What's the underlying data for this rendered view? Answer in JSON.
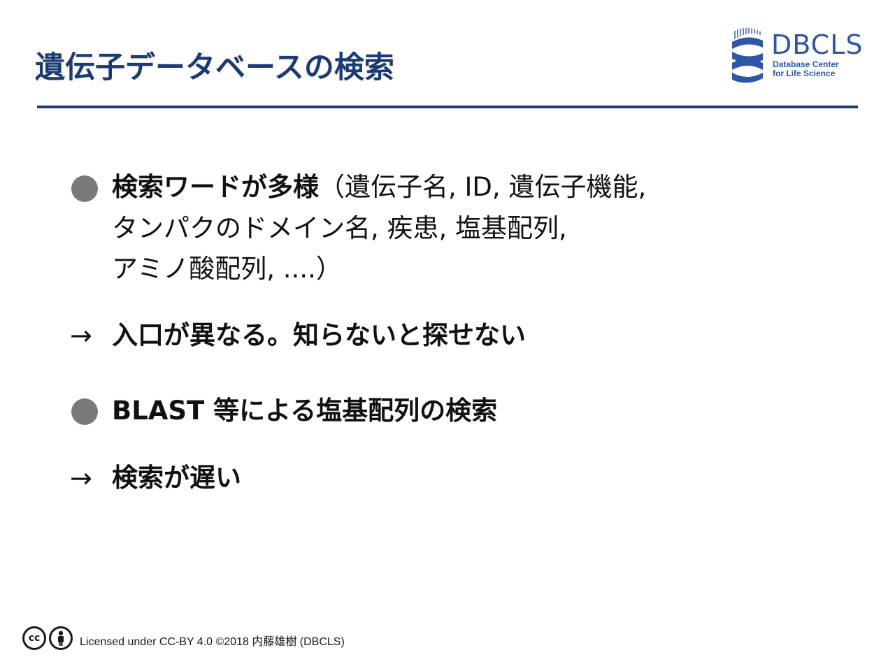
{
  "slide": {
    "title": "遺伝子データベースの検索"
  },
  "logo": {
    "wordmark": "DBCLS",
    "subtitle_line1": "Database Center",
    "subtitle_line2": "for Life Science",
    "colors": {
      "primary": "#2f57a6",
      "title": "#1c3a73"
    }
  },
  "content": {
    "bullet1": {
      "lead": "検索ワードが多様",
      "line1_rest": "（遺伝子名, ID, 遺伝子機能,",
      "line2": "タンパクのドメイン名, 疾患, 塩基配列,",
      "line3": "アミノ酸配列, ....）"
    },
    "arrow1": {
      "symbol": "→",
      "text": "入口が異なる。知らないと探せない"
    },
    "bullet2": {
      "text": "BLAST 等による塩基配列の検索"
    },
    "arrow2": {
      "symbol": "→",
      "text": "検索が遅い"
    }
  },
  "footer": {
    "cc_label": "cc",
    "license_text": "Licensed under CC-BY 4.0 ©2018 内藤雄樹 (DBCLS)",
    "icons": [
      "cc-icon",
      "by-person-icon"
    ]
  }
}
